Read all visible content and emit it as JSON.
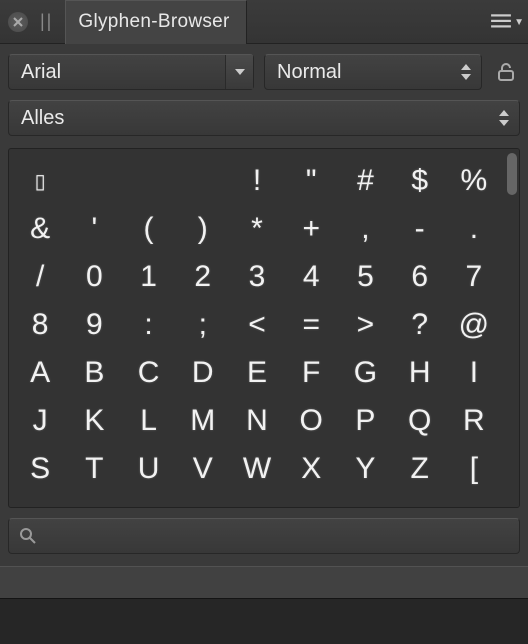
{
  "title": "Glyphen-Browser",
  "icons": {
    "close": "close-icon",
    "menu": "menu-icon",
    "lock": "lock-icon",
    "search": "search-icon"
  },
  "controls": {
    "font_select": {
      "value": "Arial"
    },
    "style_select": {
      "value": "Normal"
    },
    "range_select": {
      "value": "Alles"
    }
  },
  "search": {
    "value": "",
    "placeholder": ""
  },
  "glyph_grid": {
    "columns": 9,
    "cells": [
      "¤",
      "",
      "",
      "",
      "!",
      "\"",
      "#",
      "$",
      "%",
      "&",
      "'",
      "(",
      ")",
      "*",
      "+",
      ",",
      "-",
      ".",
      "/",
      "0",
      "1",
      "2",
      "3",
      "4",
      "5",
      "6",
      "7",
      "8",
      "9",
      ":",
      ";",
      "<",
      "=",
      ">",
      "?",
      "@",
      "A",
      "B",
      "C",
      "D",
      "E",
      "F",
      "G",
      "H",
      "I",
      "J",
      "K",
      "L",
      "M",
      "N",
      "O",
      "P",
      "Q",
      "R",
      "S",
      "T",
      "U",
      "V",
      "W",
      "X",
      "Y",
      "Z",
      "["
    ]
  }
}
